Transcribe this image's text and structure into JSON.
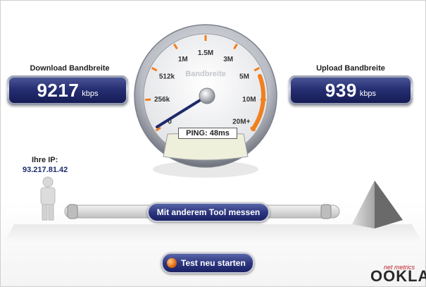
{
  "download": {
    "label": "Download Bandbreite",
    "value": "9217",
    "unit": "kbps"
  },
  "upload": {
    "label": "Upload Bandbreite",
    "value": "939",
    "unit": "kbps"
  },
  "gauge": {
    "title": "Bandbreite",
    "ticks": [
      "0",
      "256k",
      "512k",
      "1M",
      "1.5M",
      "3M",
      "5M",
      "10M",
      "20M+"
    ],
    "ping": "PING: 48ms",
    "accent_color": "#f08020"
  },
  "ip": {
    "label": "Ihre IP:",
    "value": "93.217.81.42"
  },
  "buttons": {
    "other_tool": "Mit anderem Tool messen",
    "restart": "Test neu starten"
  },
  "branding": {
    "tagline": "net metrics",
    "name": "OOKLA"
  }
}
